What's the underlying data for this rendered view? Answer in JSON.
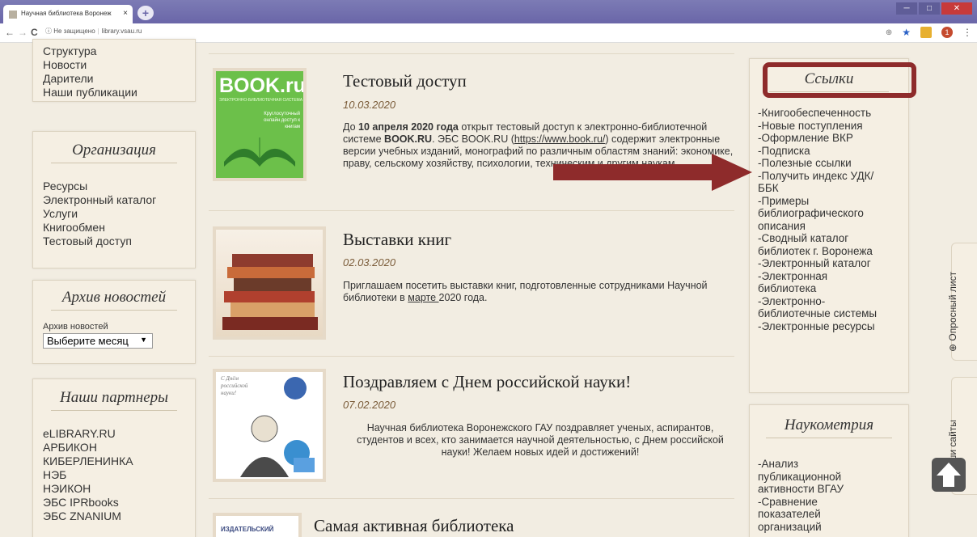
{
  "browser": {
    "tab_title": "Научная библиотека Воронеж",
    "tab_close": "×",
    "new_tab": "+",
    "nav_back": "←",
    "nav_forward": "→",
    "nav_reload": "C",
    "security": "ⓘ Не защищено",
    "url": "library.vsau.ru",
    "zoom_icon": "⊕",
    "star_icon": "★",
    "profile_badge": "1",
    "menu_icon": "⋮",
    "win_min": "─",
    "win_max": "□",
    "win_close": "✕"
  },
  "left_sidebar": {
    "top_links": [
      "Структура",
      "Новости",
      "Дарители",
      "Наши публикации"
    ],
    "organization": {
      "title": "Организация",
      "links": [
        "Ресурсы",
        "Электронный каталог",
        "Услуги",
        "Книгообмен",
        "Тестовый доступ"
      ]
    },
    "archive": {
      "title": "Архив новостей",
      "label": "Архив новостей",
      "select_value": "Выберите месяц"
    },
    "partners": {
      "title": "Наши партнеры",
      "links": [
        "eLIBRARY.RU",
        "АРБИКОН",
        "КИБЕРЛЕНИНКА",
        "НЭБ",
        "НЭИКОН",
        "ЭБС IPRbooks",
        "ЭБС ZNANIUM"
      ]
    }
  },
  "articles": [
    {
      "title": "Тестовый доступ",
      "date": "10.03.2020",
      "text_before": "До ",
      "text_bold1": "10 апреля 2020 года",
      "text_mid": " открыт тестовый доступ к электронно-библиотечной системе ",
      "text_bold2": "BOOK.RU",
      "text_mid2": ". ЭБС BOOK.RU (",
      "text_link": "https://www.book.ru/",
      "text_after": ") содержит электронные версии учебных изданий, монографий по различным областям знаний: экономике, праву, сельскому хозяйству, психологии, техническим и другим наукам.",
      "thumb": {
        "logo": "BOOK.ru",
        "subtitle": "ЭЛЕКТРОННО-БИБЛИОТЕЧНАЯ СИСТЕМА",
        "tagline": "Круглосуточный онлайн доступ к книгам"
      }
    },
    {
      "title": "Выставки книг",
      "date": "02.03.2020",
      "text_before": "Приглашаем посетить выставки книг, подготовленные сотрудниками Научной библиотеки в ",
      "text_link": "марте ",
      "text_after": "2020 года."
    },
    {
      "title": "Поздравляем с Днем российской науки!",
      "date": "07.02.2020",
      "text": "Научная библиотека Воронежского ГАУ поздравляет ученых, аспирантов, студентов и всех, кто занимается научной деятельностью, с Днем российской науки! Желаем новых идей и достижений!",
      "thumb_caption": "С Днём российской науки!"
    },
    {
      "title": "Самая активная библиотека",
      "thumb_label": "ИЗДАТЕЛЬСКИЙ"
    }
  ],
  "right_sidebar": {
    "links_panel": {
      "title": "Ссылки",
      "links": [
        "-Книгообеспеченность",
        "-Новые поступления",
        "-Оформление ВКР",
        "-Подписка",
        "-Полезные ссылки",
        "-Получить индекс УДК/",
        "ББК",
        "-Примеры",
        "библиографического",
        "описания",
        "-Сводный каталог",
        "библиотек г. Воронежа",
        "-Электронный каталог",
        "-Электронная",
        "библиотека",
        "-Электронно-",
        "библиотечные системы",
        "-Электронные ресурсы"
      ]
    },
    "scientometrics": {
      "title": "Наукометрия",
      "links": [
        "-Анализ",
        "публикационной",
        "активности ВГАУ",
        "-Сравнение",
        "показателей",
        "организаций"
      ]
    }
  },
  "side_tabs": {
    "survey": "Опросный лист",
    "sites": "Наши сайты"
  },
  "colors": {
    "highlight_box": "#8e2b2b",
    "arrow": "#8e2b2b",
    "page_bg": "#f2ede2",
    "panel_bg": "#f5efe3",
    "date": "#7a5b38",
    "book_green": "#6cc04a"
  }
}
